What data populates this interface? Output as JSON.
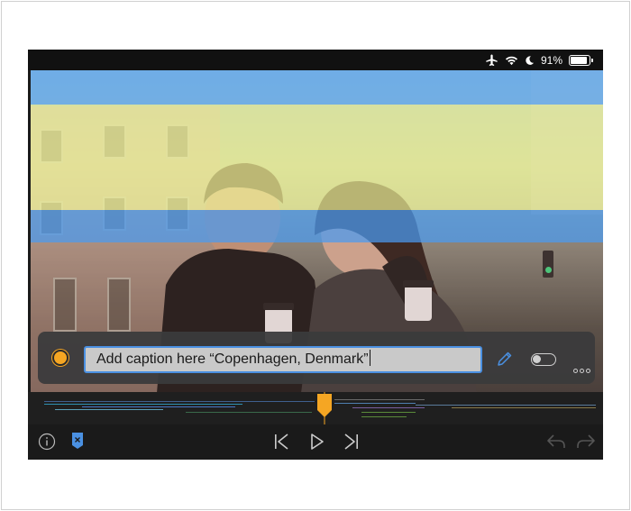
{
  "status_bar": {
    "battery_text": "91%",
    "battery_level": 0.91,
    "icons": [
      "airplane-icon",
      "wifi-icon",
      "moon-icon",
      "battery-icon"
    ]
  },
  "caption_editor": {
    "text": "Add caption here “Copenhagen, Denmark”",
    "record_color": "#f5a623",
    "accent_color": "#4a90e2",
    "toggle_on": false
  },
  "controls": {
    "icons": [
      "info-icon",
      "marker-icon",
      "skip-back-icon",
      "play-icon",
      "skip-forward-icon",
      "undo-icon",
      "redo-icon"
    ]
  }
}
